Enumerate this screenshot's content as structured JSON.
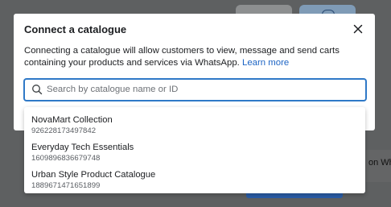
{
  "dialog": {
    "title": "Connect a catalogue",
    "description": "Connecting a catalogue will allow customers to view, message and send carts containing your products and services via WhatsApp.",
    "learn_more": "Learn more",
    "close_icon": "close-icon"
  },
  "search": {
    "placeholder": "Search by catalogue name or ID",
    "value": "",
    "icon": "search-icon"
  },
  "catalogues": [
    {
      "name": "NovaMart Collection",
      "id": "926228173497842"
    },
    {
      "name": "Everyday Tech Essentials",
      "id": "1609896836679748"
    },
    {
      "name": "Urban Style Product Catalogue",
      "id": "1889671471651899"
    }
  ],
  "background": {
    "side_text": "on Wh"
  },
  "colors": {
    "overlay": "#5e6061",
    "accent": "#2f79c7",
    "link": "#1c64c4",
    "primary_button": "#2a5ea9"
  }
}
